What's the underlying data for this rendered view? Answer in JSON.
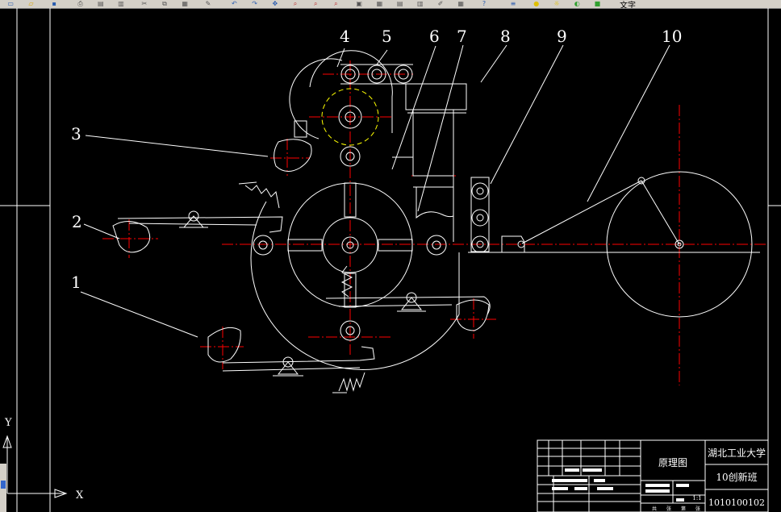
{
  "toolbar": {
    "layer_name": "文字",
    "icons": [
      "new-icon",
      "open-icon",
      "save-icon",
      "print-icon",
      "preview-icon",
      "publish-icon",
      "cut-icon",
      "copy-icon",
      "paste-icon",
      "match-icon",
      "undo-icon",
      "redo-icon",
      "pan-icon",
      "zoom-icon",
      "zoom-window-icon",
      "zoom-prev-icon",
      "properties-icon",
      "design-center-icon",
      "tool-palette-icon",
      "sheet-set-icon",
      "markup-icon",
      "calculator-icon",
      "help-icon",
      "layer-icon",
      "bulb-icon",
      "sun-icon",
      "lock-icon",
      "color-swatch-icon"
    ]
  },
  "ucs": {
    "x_label": "X",
    "y_label": "Y"
  },
  "callouts": [
    "1",
    "2",
    "3",
    "4",
    "5",
    "6",
    "7",
    "8",
    "9",
    "10"
  ],
  "title_block": {
    "drawing_name": "原理图",
    "school": "湖北工业大学",
    "class_name": "10创新班",
    "student_id": "1010100102",
    "scale": "1:1",
    "footer_cells": [
      "共",
      "张",
      "第",
      "张"
    ]
  },
  "colors": {
    "line": "#ffffff",
    "center_line": "#ff0000",
    "hidden_line": "#ffff00",
    "background": "#000000"
  }
}
